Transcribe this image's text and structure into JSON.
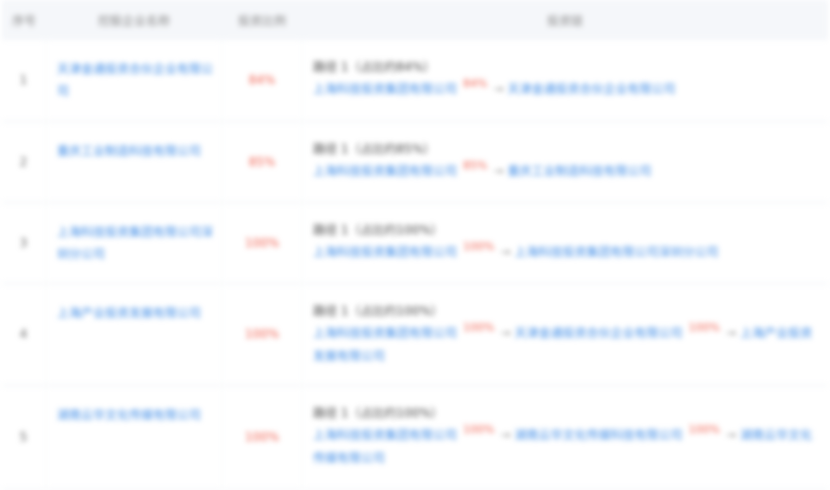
{
  "table": {
    "headers": {
      "index": "序号",
      "company": "控股企业名称",
      "ratio": "投资比例",
      "path": "投资链"
    },
    "rows": [
      {
        "index": "1",
        "company": "天津金通投资合伙企业有限公司",
        "ratio": "84%",
        "path_title": "路径 1（占比约84%）",
        "chain": [
          {
            "name": "上海科技投资集团有限公司",
            "pct": "84%"
          },
          {
            "name": "天津金通投资合伙企业有限公司",
            "pct": ""
          }
        ]
      },
      {
        "index": "2",
        "company": "重庆工业制造科技有限公司",
        "ratio": "85%",
        "path_title": "路径 1（占比约85%）",
        "chain": [
          {
            "name": "上海科技投资集团有限公司",
            "pct": "85%"
          },
          {
            "name": "重庆工业制造科技有限公司",
            "pct": ""
          }
        ]
      },
      {
        "index": "3",
        "company": "上海科技投资集团有限公司深圳分公司",
        "ratio": "100%",
        "path_title": "路径 1（占比约100%）",
        "chain": [
          {
            "name": "上海科技投资集团有限公司",
            "pct": "100%"
          },
          {
            "name": "上海科技投资集团有限公司深圳分公司",
            "pct": ""
          }
        ]
      },
      {
        "index": "4",
        "company": "上海产业投资发展有限公司",
        "ratio": "100%",
        "path_title": "路径 1（占比约100%）",
        "chain": [
          {
            "name": "上海科技投资集团有限公司",
            "pct": "100%"
          },
          {
            "name": "天津金通投资合伙企业有限公司",
            "pct": "100%"
          },
          {
            "name": "上海产业投资发展有限公司",
            "pct": ""
          }
        ]
      },
      {
        "index": "5",
        "company": "湖南云华文化传媒有限公司",
        "ratio": "100%",
        "path_title": "路径 1（占比约100%）",
        "chain": [
          {
            "name": "上海科技投资集团有限公司",
            "pct": "100%"
          },
          {
            "name": "湖南云华文化传媒科技有限公司",
            "pct": "100%"
          },
          {
            "name": "湖南云华文化传媒有限公司",
            "pct": ""
          }
        ]
      }
    ]
  }
}
